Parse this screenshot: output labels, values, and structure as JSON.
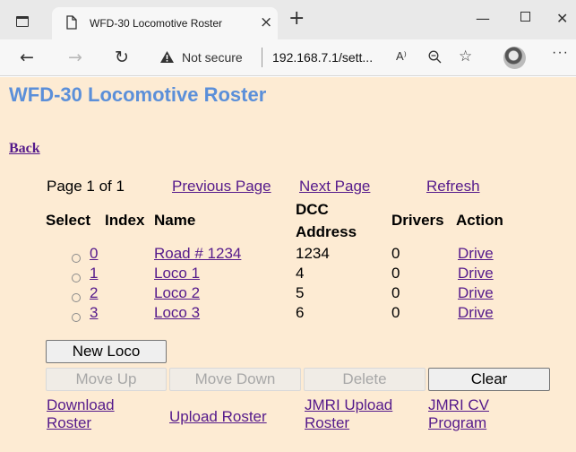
{
  "browser": {
    "tab_title": "WFD-30 Locomotive Roster",
    "tab_close": "×",
    "new_tab": "+",
    "window_minimize": "—",
    "window_close": "✕",
    "security_label": "Not secure",
    "url": "192.168.7.1/sett...",
    "read_aloud": "A⁾",
    "more": "···",
    "icons": [
      "tab-actions-icon",
      "document-icon",
      "back-arrow-icon",
      "forward-arrow-icon",
      "refresh-icon",
      "warning-icon",
      "read-aloud-icon",
      "zoom-icon",
      "favorites-icon",
      "profile-avatar",
      "more-icon"
    ]
  },
  "page": {
    "title": "WFD-30 Locomotive Roster",
    "back": "Back",
    "background": "#fdebd3",
    "title_color": "#5b8fd9",
    "link_color": "#551a8b"
  },
  "pagination": {
    "page_label": "Page 1 of 1",
    "previous": "Previous Page",
    "next": "Next Page",
    "refresh": "Refresh"
  },
  "table": {
    "headers": {
      "select": "Select",
      "index": "Index",
      "name": "Name",
      "dcc_line1": "DCC",
      "dcc_line2": "Address",
      "drivers": "Drivers",
      "action": "Action"
    },
    "rows": [
      {
        "index": "0",
        "name": "Road # 1234",
        "address": "1234",
        "drivers": "0",
        "action": "Drive"
      },
      {
        "index": "1",
        "name": "Loco 1",
        "address": "4",
        "drivers": "0",
        "action": "Drive"
      },
      {
        "index": "2",
        "name": "Loco 2",
        "address": "5",
        "drivers": "0",
        "action": "Drive"
      },
      {
        "index": "3",
        "name": "Loco 3",
        "address": "6",
        "drivers": "0",
        "action": "Drive"
      }
    ]
  },
  "buttons": {
    "new_loco": "New Loco",
    "move_up": "Move Up",
    "move_down": "Move Down",
    "delete": "Delete",
    "clear": "Clear"
  },
  "footer_links": {
    "download_roster": "Download Roster",
    "upload_roster": "Upload Roster",
    "jmri_upload_roster": "JMRI Upload Roster",
    "jmri_cv_program": "JMRI CV Program"
  }
}
